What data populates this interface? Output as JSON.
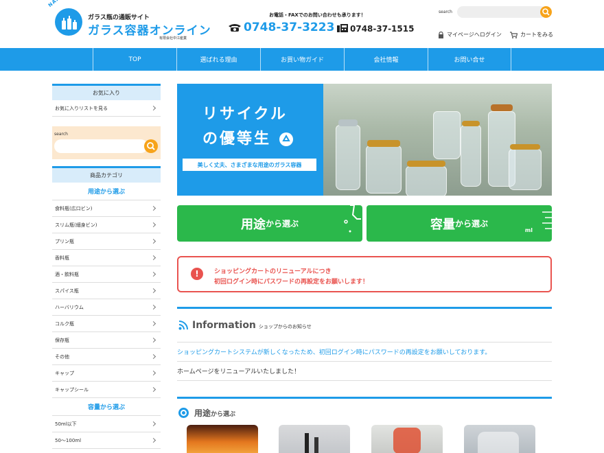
{
  "header": {
    "logo_arc": "NAKAE GLASS",
    "logo_sub": "ガラス瓶の通販サイト",
    "logo_main": "ガラス容器オンライン",
    "company": "有限会社中江産業",
    "contact_note": "お電話・FAXでのお問い合わせも承ります！",
    "tel": "0748-37-3223",
    "fax": "0748-37-1515",
    "search_label": "search",
    "mypage": "マイページへログイン",
    "cart": "カートをみる"
  },
  "nav": [
    "TOP",
    "選ばれる理由",
    "お買い物ガイド",
    "会社情報",
    "お問い合せ"
  ],
  "sidebar": {
    "fav_head": "お気に入り",
    "fav_link": "お気に入りリストを見る",
    "search_label": "search",
    "cat_head": "商品カテゴリ",
    "use_head": "用途から選ぶ",
    "use_items": [
      "食料瓶(広口ビン)",
      "スリム瓶(細身ビン)",
      "プリン瓶",
      "香料瓶",
      "酒・飲料瓶",
      "スパイス瓶",
      "ハーバリウム",
      "コルク瓶",
      "保存瓶",
      "その他",
      "キャップ",
      "キャップシール"
    ],
    "cap_head": "容量から選ぶ",
    "cap_items": [
      "50ml以下",
      "50～100ml"
    ]
  },
  "banner": {
    "title1": "リサイクル",
    "title2": "の優等生",
    "subtitle": "美しく丈夫、さまざまな用途のガラス容器"
  },
  "cta": {
    "use_big": "用途",
    "use_small": "から選ぶ",
    "cap_big": "容量",
    "cap_small": "から選ぶ",
    "ml": "ml"
  },
  "notice": {
    "line1": "ショッピングカートのリニューアルにつき",
    "line2": "初回ログイン時にパスワードの再設定をお願いします！"
  },
  "info": {
    "title": "Information",
    "sub": "ショップからのお知らせ",
    "items": [
      "ショッピングカートシステムが新しくなったため、初回ログイン時にパスワードの再設定をお願いしております。",
      "ホームページをリニューアルいたしました！"
    ]
  },
  "use_section": {
    "title_big": "用途",
    "title_small": "から選ぶ"
  },
  "colors": {
    "primary": "#1e9be8",
    "accent": "#f7a31a",
    "green": "#2bb84b",
    "alert": "#e9534f"
  }
}
